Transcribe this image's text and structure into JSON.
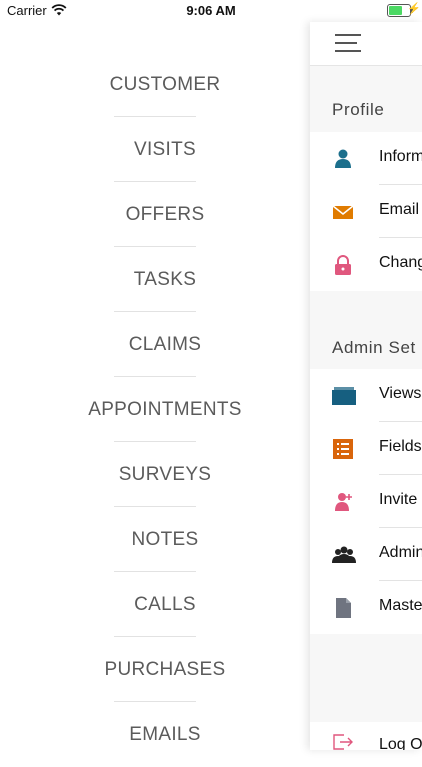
{
  "status_bar": {
    "carrier": "Carrier",
    "time": "9:06 AM"
  },
  "menu": {
    "items": [
      {
        "label": "CUSTOMER"
      },
      {
        "label": "VISITS"
      },
      {
        "label": "OFFERS"
      },
      {
        "label": "TASKS"
      },
      {
        "label": "CLAIMS"
      },
      {
        "label": "APPOINTMENTS"
      },
      {
        "label": "SURVEYS"
      },
      {
        "label": "NOTES"
      },
      {
        "label": "CALLS"
      },
      {
        "label": "PURCHASES"
      },
      {
        "label": "EMAILS"
      }
    ]
  },
  "panel": {
    "profile_title": "Profile",
    "profile_items": [
      {
        "label": "Inform",
        "icon": "person-icon"
      },
      {
        "label": "Email",
        "icon": "envelope-icon"
      },
      {
        "label": "Chang",
        "icon": "lock-icon"
      }
    ],
    "admin_title": "Admin Set",
    "admin_items": [
      {
        "label": "Views",
        "icon": "folder-icon"
      },
      {
        "label": "Fields",
        "icon": "list-icon"
      },
      {
        "label": "Invite",
        "icon": "add-user-icon"
      },
      {
        "label": "Admin",
        "icon": "users-icon"
      },
      {
        "label": "Maste",
        "icon": "document-icon"
      }
    ],
    "logout_label": "Log O"
  },
  "colors": {
    "person": "#1c6f8c",
    "envelope": "#e07b00",
    "lock": "#e0577e",
    "folder": "#165f80",
    "list": "#d9650b",
    "add_user": "#e0577e",
    "users": "#222222",
    "document": "#6f7480",
    "logout": "#e0577e"
  }
}
